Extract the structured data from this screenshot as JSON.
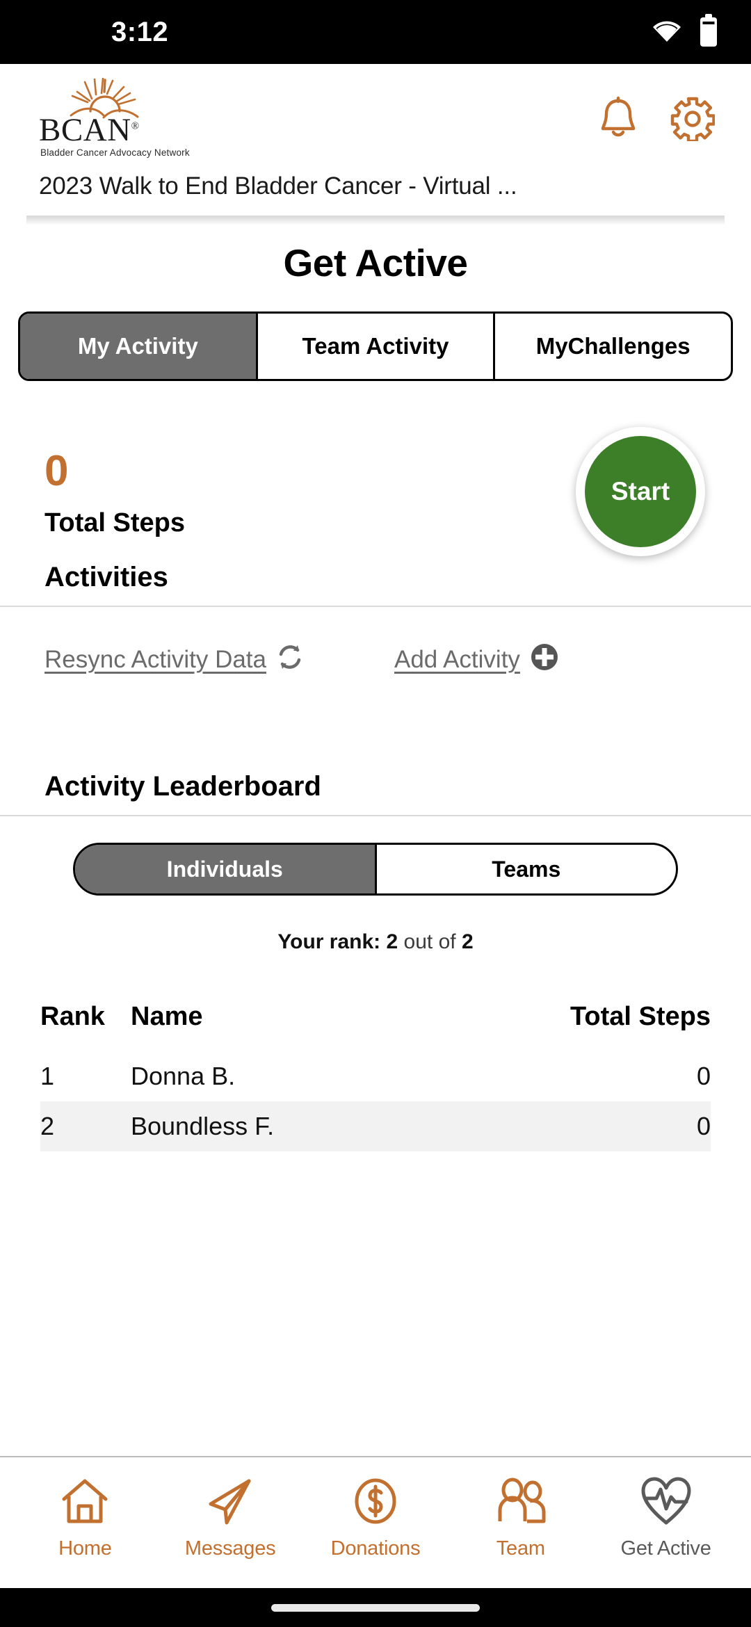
{
  "status_bar": {
    "time": "3:12",
    "wifi_icon": "wifi-icon",
    "battery_icon": "battery-icon"
  },
  "header": {
    "logo_name": "BCAN",
    "logo_registered": "®",
    "logo_tagline": "Bladder Cancer Advocacy Network",
    "logo_sun_icon": "sunrise-logo-icon",
    "notifications_icon": "bell-icon",
    "settings_icon": "gear-icon",
    "event_title": "2023 Walk to End Bladder Cancer - Virtual ..."
  },
  "page": {
    "title": "Get Active"
  },
  "tabs": [
    {
      "label": "My Activity",
      "active": true
    },
    {
      "label": "Team Activity",
      "active": false
    },
    {
      "label": "My\nChallenges",
      "active": false
    }
  ],
  "summary": {
    "total_steps_value": "0",
    "total_steps_label": "Total Steps",
    "start_button_label": "Start"
  },
  "activities": {
    "heading": "Activities",
    "resync_label": "Resync Activity Data",
    "resync_icon": "refresh-icon",
    "add_label": "Add Activity",
    "add_icon": "plus-circle-icon"
  },
  "leaderboard": {
    "heading": "Activity Leaderboard",
    "toggle": [
      {
        "label": "Individuals",
        "active": true
      },
      {
        "label": "Teams",
        "active": false
      }
    ],
    "rank_prefix": "Your rank:",
    "rank_value": "2",
    "rank_middle": "out of",
    "rank_total": "2",
    "columns": [
      "Rank",
      "Name",
      "Total Steps"
    ],
    "rows": [
      {
        "rank": "1",
        "name": "Donna B.",
        "steps": "0",
        "highlighted": false
      },
      {
        "rank": "2",
        "name": "Boundless F.",
        "steps": "0",
        "highlighted": true
      }
    ]
  },
  "bottom_nav": [
    {
      "label": "Home",
      "icon": "home-icon",
      "current": false
    },
    {
      "label": "Messages",
      "icon": "paper-plane-icon",
      "current": false
    },
    {
      "label": "Donations",
      "icon": "dollar-circle-icon",
      "current": false
    },
    {
      "label": "Team",
      "icon": "people-icon",
      "current": false
    },
    {
      "label": "Get Active",
      "icon": "heart-pulse-icon",
      "current": true
    }
  ],
  "colors": {
    "brand_orange": "#c2702f",
    "start_green": "#3d7f29",
    "segment_active_gray": "#6e6e6e",
    "row_highlight": "#f2f2f2",
    "nav_current_gray": "#5a5a5a"
  }
}
